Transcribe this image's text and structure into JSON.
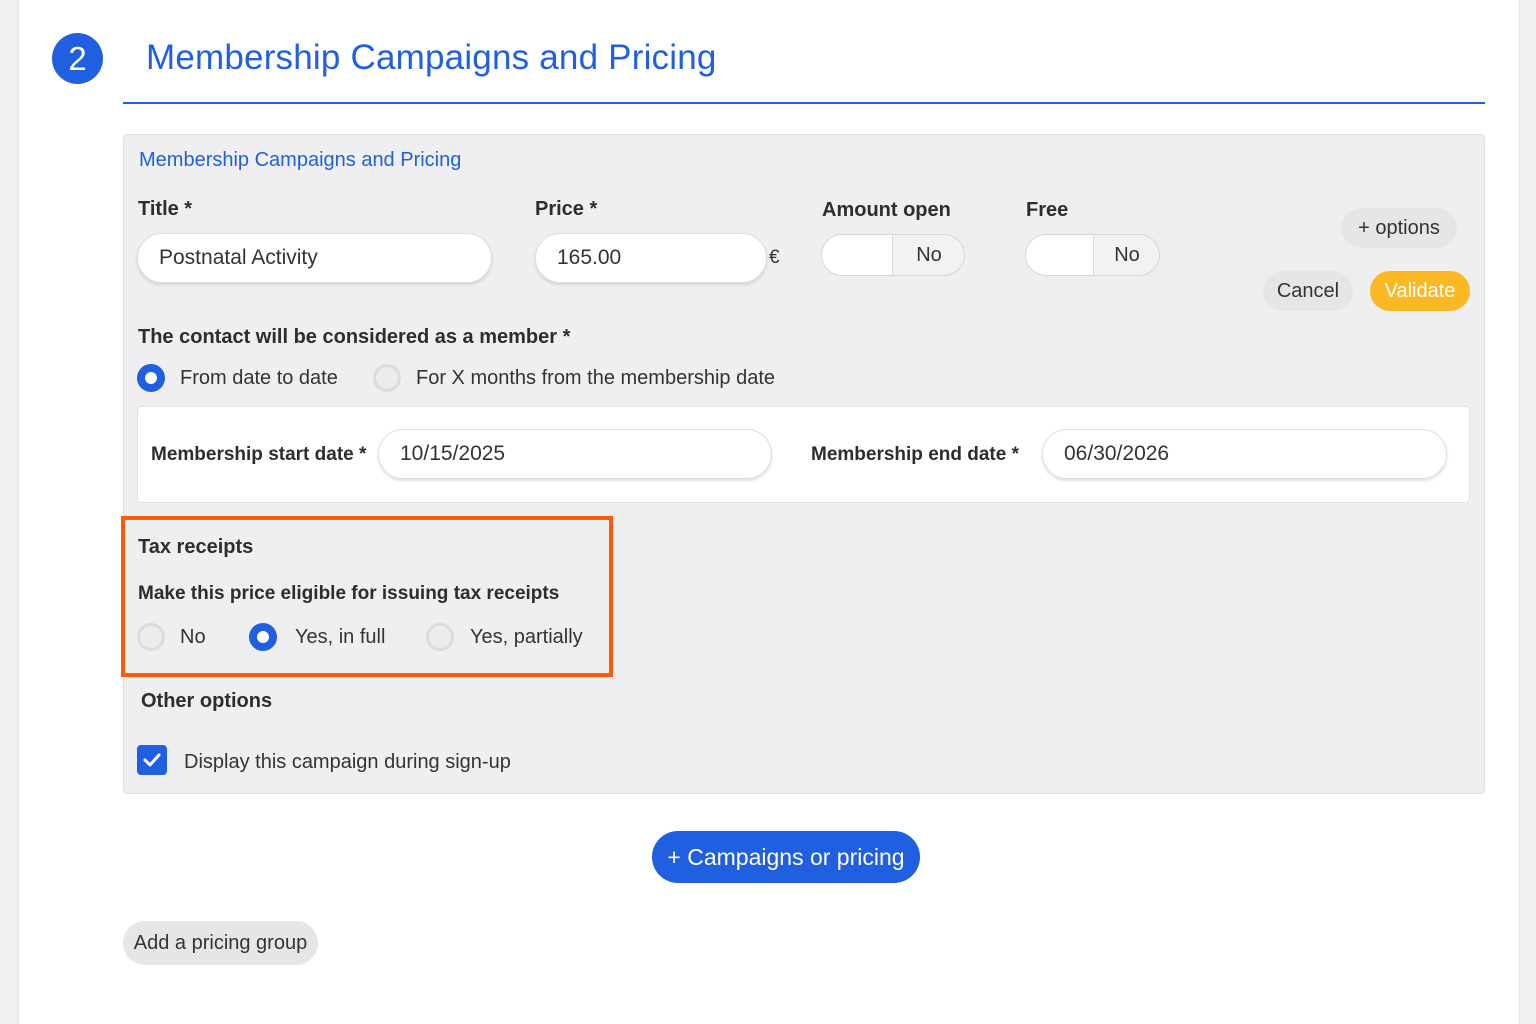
{
  "header": {
    "step_number": "2",
    "title": "Membership Campaigns and Pricing"
  },
  "panel": {
    "title": "Membership Campaigns and Pricing",
    "fields": {
      "title_label": "Title *",
      "title_value": "Postnatal Activity",
      "price_label": "Price *",
      "price_value": "165.00",
      "currency": "€",
      "amount_open_label": "Amount open",
      "amount_open_value": "No",
      "free_label": "Free",
      "free_value": "No"
    },
    "buttons": {
      "options": "+ options",
      "cancel": "Cancel",
      "validate": "Validate"
    },
    "membership": {
      "label": "The contact will be considered as a member *",
      "option_date_to_date": "From date to date",
      "option_x_months": "For X months from the membership date",
      "selected": "From date to date",
      "start_label": "Membership start date *",
      "start_value": "10/15/2025",
      "end_label": "Membership end date *",
      "end_value": "06/30/2026"
    },
    "tax_receipts": {
      "heading": "Tax receipts",
      "question": "Make this price eligible for issuing tax receipts",
      "options": [
        "No",
        "Yes, in full",
        "Yes, partially"
      ],
      "selected": "Yes, in full"
    },
    "other_options": {
      "heading": "Other options",
      "display_signup_label": "Display this campaign during sign-up",
      "display_signup_checked": true
    }
  },
  "actions": {
    "add_campaign": "+ Campaigns or pricing",
    "add_pricing_group": "Add a pricing group"
  },
  "colors": {
    "accent_blue": "#1f5fe0",
    "validate_yellow": "#f9b824",
    "highlight_orange": "#ff5a0a"
  }
}
